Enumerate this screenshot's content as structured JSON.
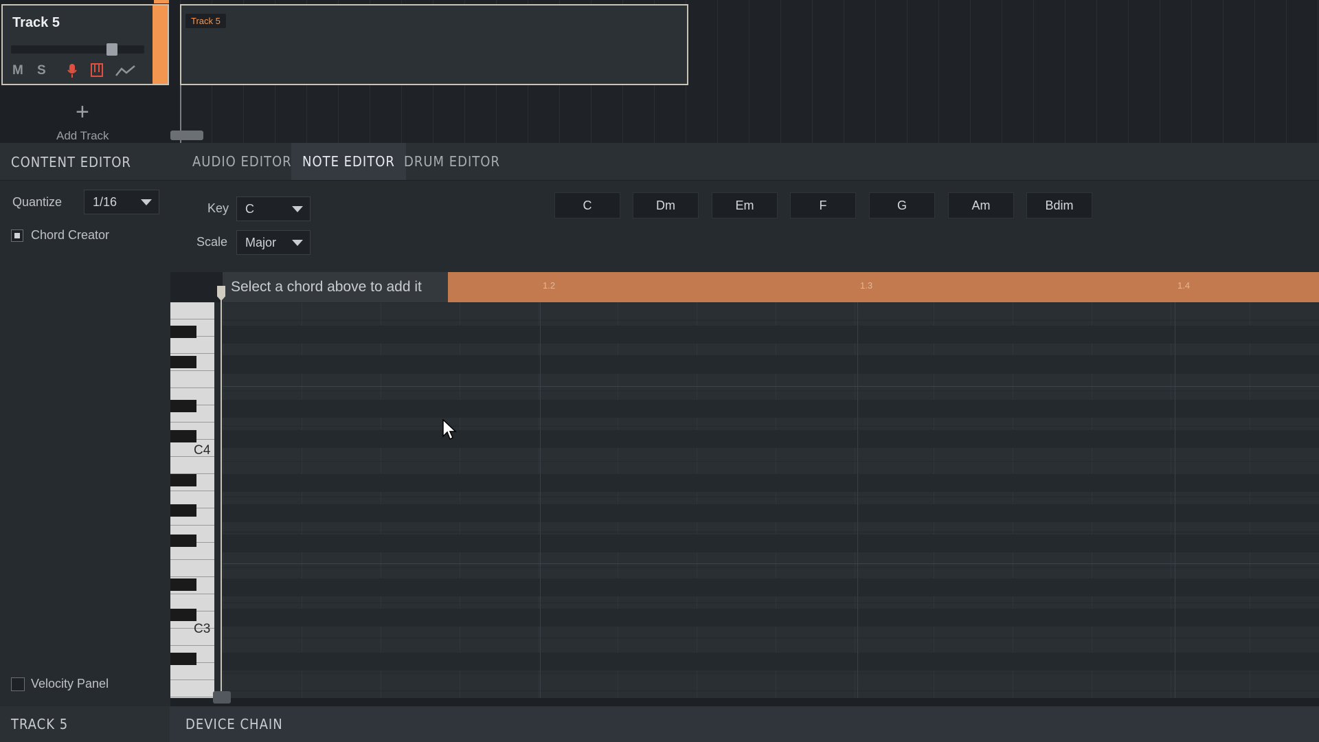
{
  "arrangement": {
    "track": {
      "name": "Track 5",
      "color": "#f39750",
      "buttons": {
        "mute": "M",
        "solo": "S"
      },
      "volume_level": 0.78
    },
    "clip": {
      "label": "Track 5"
    },
    "add_track": {
      "icon": "+",
      "label": "Add Track"
    }
  },
  "content_editor": {
    "title": "CONTENT EDITOR",
    "quantize": {
      "label": "Quantize",
      "value": "1/16"
    },
    "chord_creator": {
      "label": "Chord Creator",
      "checked": true
    },
    "velocity_panel": {
      "label": "Velocity Panel",
      "checked": false
    }
  },
  "tabs": [
    {
      "label": "AUDIO EDITOR",
      "active": false
    },
    {
      "label": "NOTE EDITOR",
      "active": true
    },
    {
      "label": "DRUM EDITOR",
      "active": false
    }
  ],
  "note_editor": {
    "key": {
      "label": "Key",
      "value": "C"
    },
    "scale": {
      "label": "Scale",
      "value": "Major"
    },
    "chords": [
      "C",
      "Dm",
      "Em",
      "F",
      "G",
      "Am",
      "Bdim"
    ],
    "hint": "Select a chord above to add it",
    "ruler": [
      "1.2",
      "1.3",
      "1.4"
    ],
    "octave_labels": [
      "C4",
      "C3"
    ]
  },
  "bottom": {
    "track_title": "TRACK 5",
    "device_chain": "DEVICE CHAIN"
  },
  "colors": {
    "accent": "#f39750",
    "ruler": "#c27a4e"
  }
}
